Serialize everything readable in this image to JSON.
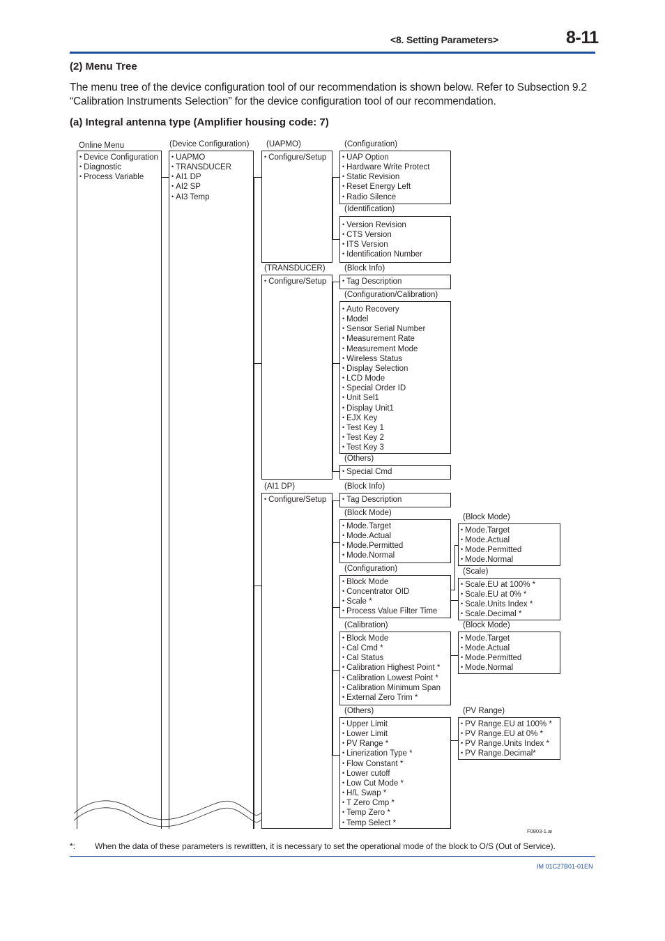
{
  "header": {
    "section": "<8.  Setting Parameters>",
    "page": "8-11"
  },
  "section_title": "(2)   Menu Tree",
  "intro": "The menu tree of the device configuration tool of our recommendation is shown below. Refer to Subsection 9.2 “Calibration Instruments Selection” for the device configuration tool of our recommendation.",
  "subsection_title": "(a)   Integral antenna type (Amplifier housing code: 7)",
  "tree": {
    "online_menu": {
      "label": "Online Menu",
      "items": [
        "Device Configuration",
        "Diagnostic",
        "Process Variable"
      ]
    },
    "device_configuration": {
      "label": "(Device Configuration)",
      "items": [
        "UAPMO",
        "TRANSDUCER",
        "AI1 DP",
        "AI2 SP",
        "AI3 Temp"
      ]
    },
    "uapmo": {
      "label": "(UAPMO)",
      "items": [
        "Configure/Setup"
      ],
      "configuration": {
        "label": "(Configuration)",
        "items": [
          "UAP Option",
          "Hardware Write Protect",
          "Static Revision",
          "Reset Energy Left",
          "Radio Silence"
        ]
      },
      "identification": {
        "label": "(Identification)",
        "items": [
          "Version Revision",
          "CTS Version",
          "ITS Version",
          "Identification Number"
        ]
      }
    },
    "transducer": {
      "label": "(TRANSDUCER)",
      "items": [
        "Configure/Setup"
      ],
      "block_info": {
        "label": "(Block Info)",
        "items": [
          "Tag Description"
        ]
      },
      "config_calibration": {
        "label": "(Configuration/Calibration)",
        "items": [
          "Auto Recovery",
          "Model",
          "Sensor Serial Number",
          "Measurement Rate",
          "Measurement Mode",
          "Wireless Status",
          "Display Selection",
          "LCD Mode",
          "Special Order ID",
          "Unit Sel1",
          "Display Unit1",
          "EJX Key",
          "Test Key 1",
          "Test Key 2",
          "Test Key 3"
        ]
      },
      "others": {
        "label": "(Others)",
        "items": [
          "Special Cmd"
        ]
      }
    },
    "ai1dp": {
      "label": "(AI1 DP)",
      "items": [
        "Configure/Setup"
      ],
      "block_info": {
        "label": "(Block Info)",
        "items": [
          "Tag Description"
        ]
      },
      "block_mode": {
        "label": "(Block Mode)",
        "items": [
          "Mode.Target",
          "Mode.Actual",
          "Mode.Permitted",
          "Mode.Normal"
        ]
      },
      "configuration": {
        "label": "(Configuration)",
        "items": [
          "Block Mode",
          "Concentrator OID",
          "Scale *",
          "Process Value Filter Time"
        ]
      },
      "config_block_mode": {
        "label": "(Block Mode)",
        "items": [
          "Mode.Target",
          "Mode.Actual",
          "Mode.Permitted",
          "Mode.Normal"
        ]
      },
      "scale": {
        "label": "(Scale)",
        "items": [
          "Scale.EU at 100% *",
          "Scale.EU at 0% *",
          "Scale.Units Index *",
          "Scale.Decimal *"
        ]
      },
      "calibration": {
        "label": "(Calibration)",
        "items": [
          "Block Mode",
          "Cal Cmd *",
          "Cal Status",
          "Calibration Highest Point *",
          "Calibration Lowest Point *",
          "Calibration Minimum Span",
          "External Zero Trim *"
        ]
      },
      "cal_block_mode": {
        "label": "(Block Mode)",
        "items": [
          "Mode.Target",
          "Mode.Actual",
          "Mode.Permitted",
          "Mode.Normal"
        ]
      },
      "others": {
        "label": "(Others)",
        "items": [
          "Upper Limit",
          "Lower Limit",
          "PV Range *",
          "Linerization Type *",
          "Flow Constant *",
          "Lower cutoff",
          "Low Cut Mode *",
          "H/L Swap *",
          "T Zero Cmp *",
          "Temp Zero *",
          "Temp Select *"
        ]
      },
      "pv_range": {
        "label": "(PV Range)",
        "items": [
          "PV Range.EU at 100% *",
          "PV Range.EU at 0% *",
          "PV Range.Units Index *",
          "PV Range.Decimal*"
        ]
      }
    }
  },
  "figure_id": "F0803-1.ai",
  "footnote": {
    "mark": "*:",
    "text": "When the data of these parameters is rewritten, it is necessary to set the operational mode of the block to O/S (Out of Service)."
  },
  "doc_id": "IM 01C27B01-01EN"
}
